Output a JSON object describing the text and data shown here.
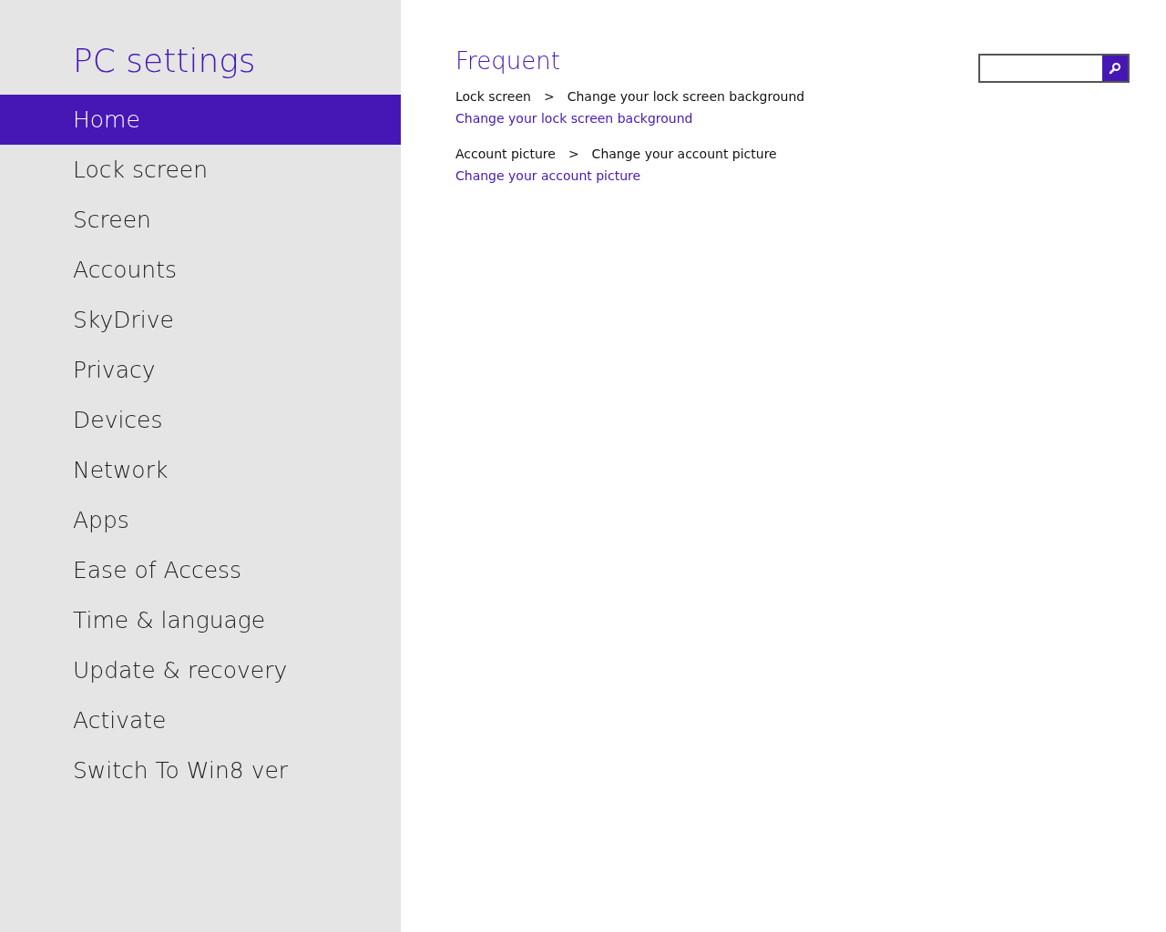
{
  "sidebar": {
    "title": "PC settings",
    "items": [
      {
        "label": "Home",
        "selected": true
      },
      {
        "label": "Lock screen",
        "selected": false
      },
      {
        "label": "Screen",
        "selected": false
      },
      {
        "label": "Accounts",
        "selected": false
      },
      {
        "label": "SkyDrive",
        "selected": false
      },
      {
        "label": "Privacy",
        "selected": false
      },
      {
        "label": "Devices",
        "selected": false
      },
      {
        "label": "Network",
        "selected": false
      },
      {
        "label": "Apps",
        "selected": false
      },
      {
        "label": "Ease of Access",
        "selected": false
      },
      {
        "label": "Time & language",
        "selected": false
      },
      {
        "label": "Update & recovery",
        "selected": false
      },
      {
        "label": "Activate",
        "selected": false
      },
      {
        "label": "Switch To Win8 ver",
        "selected": false
      }
    ]
  },
  "content": {
    "heading": "Frequent",
    "entries": [
      {
        "section": "Lock screen",
        "separator": ">",
        "setting": "Change your lock screen background",
        "link": "Change your lock screen background"
      },
      {
        "section": "Account picture",
        "separator": ">",
        "setting": "Change your account picture",
        "link": "Change your account picture"
      }
    ]
  }
}
